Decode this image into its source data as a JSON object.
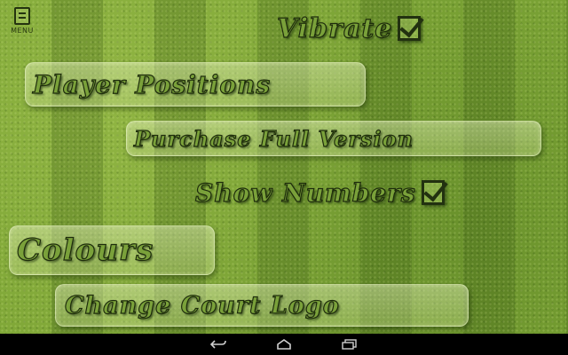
{
  "menu": {
    "label": "MENU",
    "icon": "menu-icon"
  },
  "options": {
    "vibrate": {
      "label": "Vibrate",
      "checked": true,
      "icon": "checkbox-checked-icon"
    },
    "player_positions": {
      "label": "Player Positions"
    },
    "purchase": {
      "label": "Purchase Full Version"
    },
    "show_numbers": {
      "label": "Show Numbers",
      "checked": true,
      "icon": "checkbox-checked-icon"
    },
    "colours": {
      "label": "Colours"
    },
    "change_logo": {
      "label": "Change Court Logo"
    }
  },
  "navbar": {
    "buttons": [
      "back-icon",
      "home-icon",
      "recent-apps-icon"
    ]
  },
  "colors": {
    "grass": "#7da536",
    "text_fill": "#7aa13a",
    "text_outline": "#1e2c0c",
    "navbar": "#000000"
  }
}
